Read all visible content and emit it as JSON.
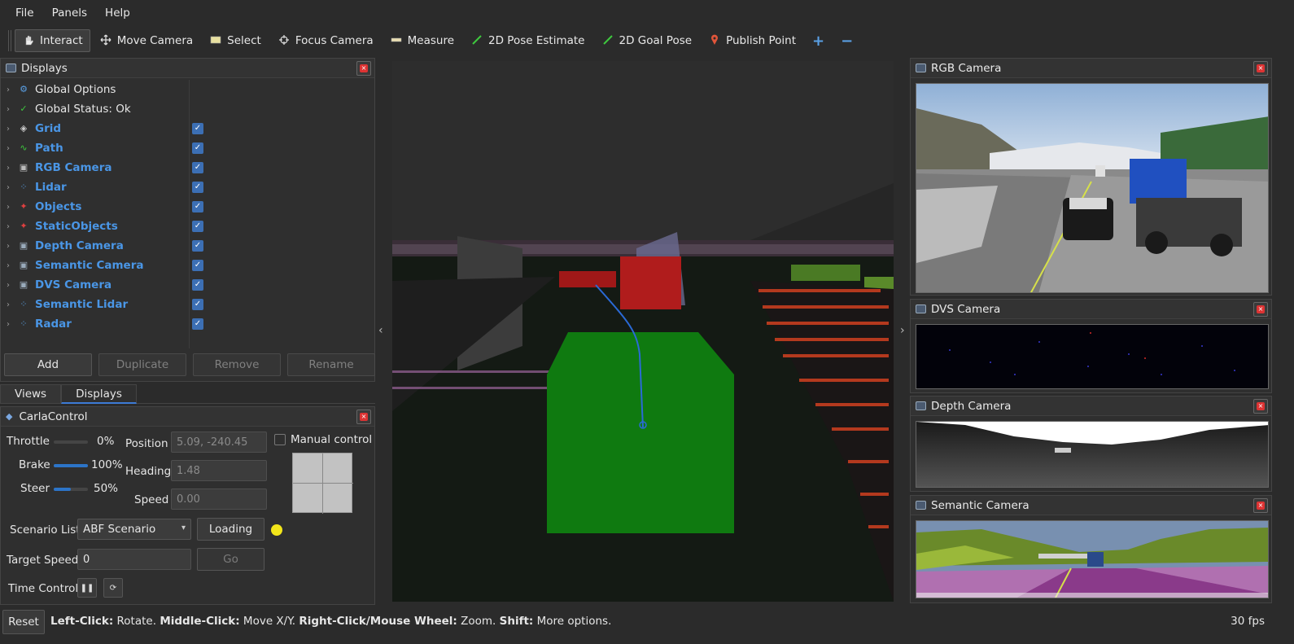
{
  "menu": [
    "File",
    "Panels",
    "Help"
  ],
  "toolbar": {
    "tools": [
      {
        "label": "Interact",
        "icon": "hand-pointer-icon",
        "active": true
      },
      {
        "label": "Move Camera",
        "icon": "move-arrows-icon"
      },
      {
        "label": "Select",
        "icon": "select-box-icon"
      },
      {
        "label": "Focus Camera",
        "icon": "crosshair-icon"
      },
      {
        "label": "Measure",
        "icon": "ruler-icon"
      },
      {
        "label": "2D Pose Estimate",
        "icon": "green-arrow-icon"
      },
      {
        "label": "2D Goal Pose",
        "icon": "green-arrow-icon"
      },
      {
        "label": "Publish Point",
        "icon": "map-pin-icon"
      }
    ],
    "add_symbol": "+",
    "remove_symbol": "−"
  },
  "displays": {
    "title": "Displays",
    "items": [
      {
        "label": "Global Options",
        "icon": "gear-icon",
        "style": "white",
        "checked": null
      },
      {
        "label": "Global Status: Ok",
        "icon": "check-icon",
        "style": "white",
        "checked": null
      },
      {
        "label": "Grid",
        "icon": "grid-icon",
        "style": "blue",
        "checked": true
      },
      {
        "label": "Path",
        "icon": "path-icon",
        "style": "blue",
        "checked": true
      },
      {
        "label": "RGB Camera",
        "icon": "camera-icon",
        "style": "blue",
        "checked": true
      },
      {
        "label": "Lidar",
        "icon": "pointcloud-icon",
        "style": "blue",
        "checked": true
      },
      {
        "label": "Objects",
        "icon": "marker-icon",
        "style": "blue",
        "checked": true
      },
      {
        "label": "StaticObjects",
        "icon": "marker-icon",
        "style": "blue",
        "checked": true
      },
      {
        "label": "Depth Camera",
        "icon": "image-icon",
        "style": "blue",
        "checked": true
      },
      {
        "label": "Semantic Camera",
        "icon": "image-icon",
        "style": "blue",
        "checked": true
      },
      {
        "label": "DVS Camera",
        "icon": "image-icon",
        "style": "blue",
        "checked": true
      },
      {
        "label": "Semantic Lidar",
        "icon": "pointcloud-icon",
        "style": "blue",
        "checked": true
      },
      {
        "label": "Radar",
        "icon": "pointcloud-icon",
        "style": "blue",
        "checked": true
      }
    ],
    "buttons": {
      "add": "Add",
      "duplicate": "Duplicate",
      "remove": "Remove",
      "rename": "Rename"
    }
  },
  "tabs": {
    "views": "Views",
    "displays": "Displays",
    "active": "Displays"
  },
  "carla": {
    "title": "CarlaControl",
    "throttle_label": "Throttle",
    "throttle_value": "0%",
    "throttle_level": 0.0,
    "brake_label": "Brake",
    "brake_value": "100%",
    "brake_level": 1.0,
    "steer_label": "Steer",
    "steer_value": "50%",
    "steer_level": 0.5,
    "position_label": "Position",
    "position_value": "5.09, -240.45",
    "heading_label": "Heading",
    "heading_value": "1.48",
    "speed_label": "Speed",
    "speed_value": "0.00",
    "manual_label": "Manual control",
    "scenario_label": "Scenario List",
    "scenario_value": "ABF Scenario",
    "loading_label": "Loading",
    "target_label": "Target Speed",
    "target_value": "0",
    "go_label": "Go",
    "time_label": "Time Control",
    "pause_symbol": "❚❚",
    "step_symbol": "⟳",
    "status_color": "#f2e51a"
  },
  "cameras": {
    "rgb": "RGB Camera",
    "dvs": "DVS Camera",
    "depth": "Depth Camera",
    "semantic": "Semantic Camera"
  },
  "status": {
    "reset": "Reset",
    "help": [
      {
        "bold": "Left-Click:",
        "text": " Rotate. "
      },
      {
        "bold": "Middle-Click:",
        "text": " Move X/Y. "
      },
      {
        "bold": "Right-Click/Mouse Wheel:",
        "text": " Zoom. "
      },
      {
        "bold": "Shift:",
        "text": " More options."
      }
    ],
    "fps": "30 fps"
  }
}
